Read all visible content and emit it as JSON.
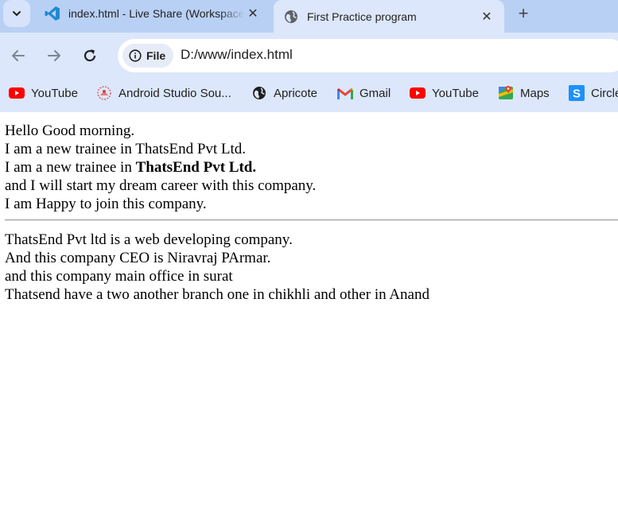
{
  "tabs": [
    {
      "title": "index.html - Live Share (Workspace)",
      "icon": "vscode-icon",
      "active": false
    },
    {
      "title": "First Practice program",
      "icon": "globe-icon",
      "active": true
    }
  ],
  "toolbar": {
    "site_chip": "File",
    "url": "D:/www/index.html"
  },
  "bookmarks": [
    {
      "label": "YouTube",
      "icon": "youtube-icon"
    },
    {
      "label": "Android Studio Sou...",
      "icon": "android-studio-icon"
    },
    {
      "label": "Apricote",
      "icon": "globe-icon"
    },
    {
      "label": "Gmail",
      "icon": "gmail-icon"
    },
    {
      "label": "YouTube",
      "icon": "youtube-icon"
    },
    {
      "label": "Maps",
      "icon": "maps-icon"
    },
    {
      "label": "Circle",
      "icon": "circle-s-icon"
    }
  ],
  "page": {
    "block1": {
      "line1": "Hello Good morning.",
      "line2": "I am a new trainee in ThatsEnd Pvt Ltd.",
      "line3_prefix": "I am a new trainee in ",
      "line3_bold": "ThatsEnd Pvt Ltd.",
      "line4": "and I will start my dream career with this company.",
      "line5": "I am Happy to join this company."
    },
    "block2": {
      "line1": "ThatsEnd Pvt ltd is a web developing company.",
      "line2": "And this company CEO is Niravraj PArmar.",
      "line3": "and this company main office in surat",
      "line4": "Thatsend have a two another branch one in chikhli and other in Anand"
    }
  }
}
